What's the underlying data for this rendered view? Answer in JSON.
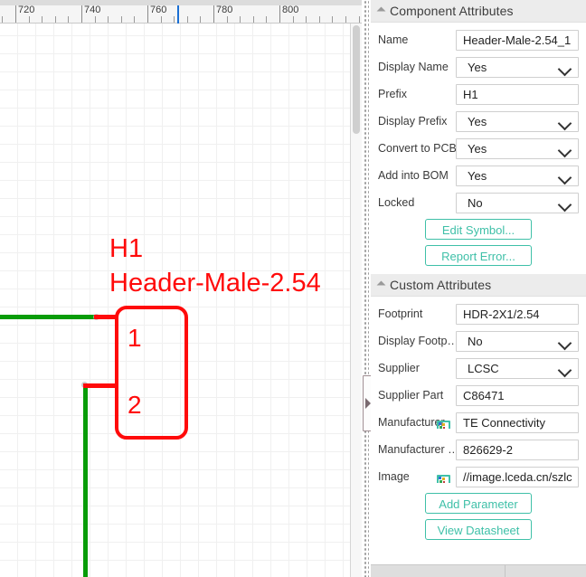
{
  "canvas": {
    "ruler": {
      "labels": [
        "720",
        "740",
        "760",
        "780",
        "800"
      ],
      "cursor_position": "762"
    },
    "symbol": {
      "prefix": "H1",
      "name": "Header-Male-2.54",
      "pin1": "1",
      "pin2": "2",
      "wire_color": "#089c08",
      "symbol_color": "#ff0a0a"
    }
  },
  "panel": {
    "component_attributes": {
      "title": "Component Attributes",
      "rows": [
        {
          "label": "Name",
          "value": "Header-Male-2.54_1",
          "type": "text"
        },
        {
          "label": "Display Name",
          "value": "Yes",
          "type": "select"
        },
        {
          "label": "Prefix",
          "value": "H1",
          "type": "text"
        },
        {
          "label": "Display Prefix",
          "value": "Yes",
          "type": "select"
        },
        {
          "label": "Convert to PCB",
          "value": "Yes",
          "type": "select"
        },
        {
          "label": "Add into BOM",
          "value": "Yes",
          "type": "select"
        },
        {
          "label": "Locked",
          "value": "No",
          "type": "select"
        }
      ],
      "buttons": [
        {
          "label": "Edit Symbol..."
        },
        {
          "label": "Report Error..."
        }
      ]
    },
    "custom_attributes": {
      "title": "Custom Attributes",
      "rows": [
        {
          "label": "Footprint",
          "value": "HDR-2X1/2.54",
          "type": "text",
          "icon": ""
        },
        {
          "label": "Display Footp…",
          "value": "No",
          "type": "select",
          "icon": ""
        },
        {
          "label": "Supplier",
          "value": "LCSC",
          "type": "select",
          "icon": ""
        },
        {
          "label": "Supplier Part",
          "value": "C86471",
          "type": "text",
          "icon": ""
        },
        {
          "label": "Manufacturer",
          "value": "TE Connectivity",
          "type": "text",
          "icon": "image-link-icon"
        },
        {
          "label": "Manufacturer …",
          "value": "826629-2",
          "type": "text",
          "icon": ""
        },
        {
          "label": "Image",
          "value": "//image.lceda.cn/szlc",
          "type": "text",
          "icon": "image-link-icon"
        }
      ],
      "buttons": [
        {
          "label": "Add Parameter"
        },
        {
          "label": "View Datasheet"
        }
      ]
    },
    "accent_color": "#3fc0a8"
  }
}
